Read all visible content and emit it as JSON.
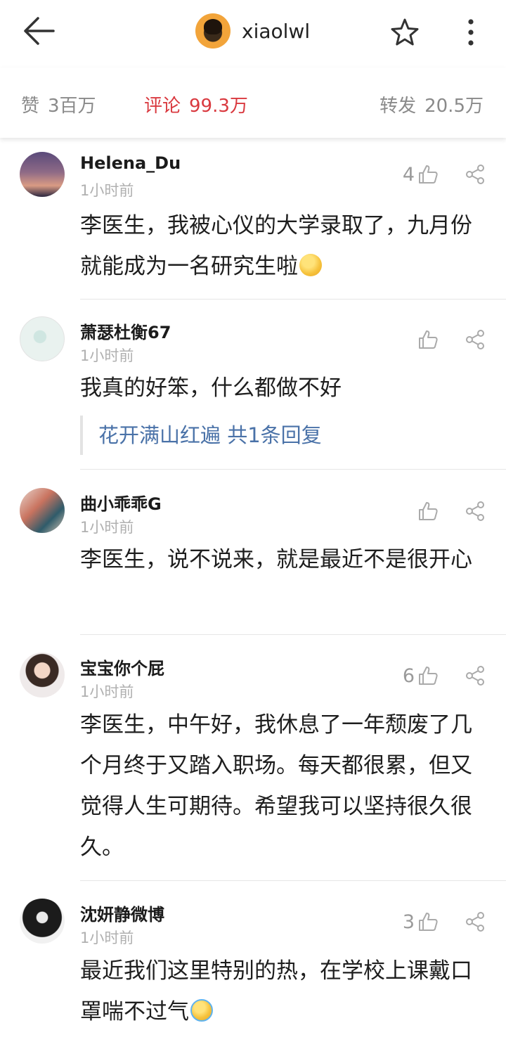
{
  "header": {
    "username": "xiaolwl",
    "back_icon": "arrow-left-icon",
    "star_icon": "star-outline-icon",
    "more_icon": "more-vertical-icon"
  },
  "stats": {
    "like_label": "赞",
    "like_count": "3百万",
    "comment_label": "评论",
    "comment_count": "99.3万",
    "repost_label": "转发",
    "repost_count": "20.5万",
    "active_color": "#d9393f"
  },
  "comments": [
    {
      "name": "Helena_Du",
      "time": "1小时前",
      "likes": "4",
      "text": "李医生，我被心仪的大学录取了，九月份就能成为一名研究生啦",
      "emoji": "kissing-face-emoji"
    },
    {
      "name": "萧瑟杜衡67",
      "time": "1小时前",
      "likes": "",
      "text": "我真的好笨，什么都做不好",
      "reply": "花开满山红遍 共1条回复"
    },
    {
      "name": "曲小乖乖G",
      "time": "1小时前",
      "likes": "",
      "text": "李医生，说不说来，就是最近不是很开心"
    },
    {
      "name": "宝宝你个屁",
      "time": "1小时前",
      "likes": "6",
      "text": "李医生，中午好，我休息了一年颓废了几个月终于又踏入职场。每天都很累，但又觉得人生可期待。希望我可以坚持很久很久。"
    },
    {
      "name": "沈妍静微博",
      "time": "1小时前",
      "likes": "3",
      "text": "最近我们这里特别的热，在学校上课戴口罩喘不过气",
      "emoji": "crying-face-emoji"
    }
  ]
}
